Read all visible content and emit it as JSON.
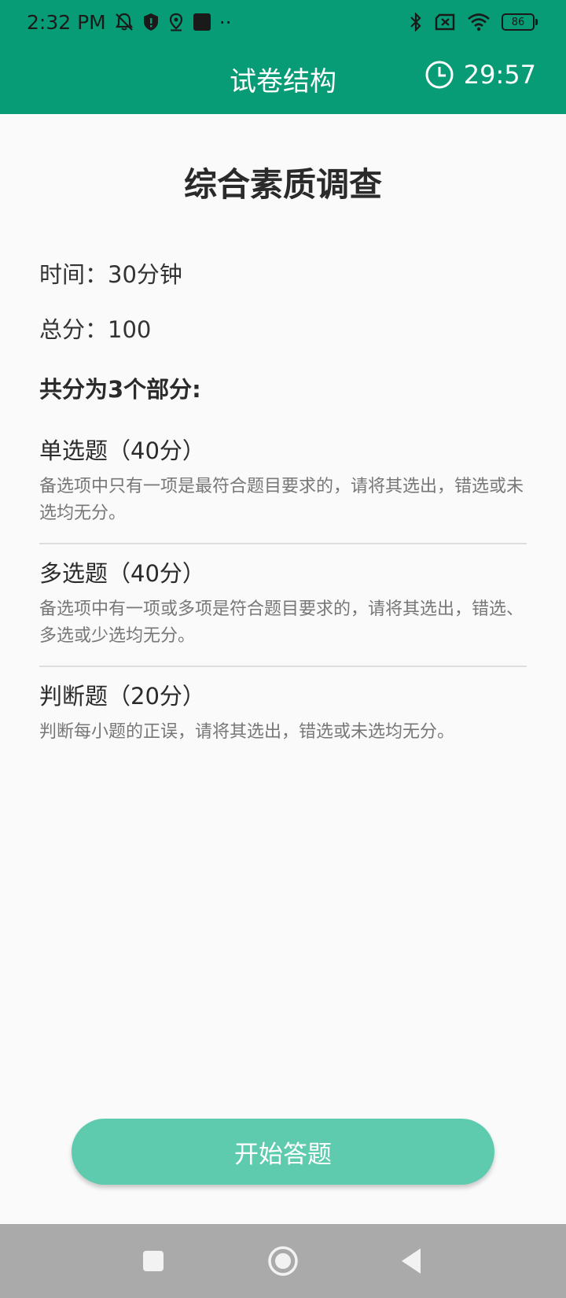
{
  "status_bar": {
    "time": "2:32 PM",
    "dots": "··",
    "battery": "86",
    "icons_left": [
      "muted-notification-icon",
      "shield-icon",
      "location-icon",
      "app-square-icon"
    ],
    "icons_right": [
      "bluetooth-icon",
      "no-sim-icon",
      "wifi-icon",
      "battery-icon"
    ]
  },
  "app_bar": {
    "title": "试卷结构",
    "timer": "29:57",
    "timer_icon": "clock-icon"
  },
  "exam": {
    "title": "综合素质调查",
    "time_label": "时间：30分钟",
    "score_label": "总分：100",
    "parts_heading": "共分为3个部分:",
    "sections": [
      {
        "title": "单选题（40分）",
        "description": "备选项中只有一项是最符合题目要求的，请将其选出，错选或未选均无分。"
      },
      {
        "title": "多选题（40分）",
        "description": "备选项中有一项或多项是符合题目要求的，请将其选出，错选、多选或少选均无分。"
      },
      {
        "title": "判断题（20分）",
        "description": "判断每小题的正误，请将其选出，错选或未选均无分。"
      }
    ]
  },
  "start_button": "开始答题",
  "nav_bar": {
    "icons": [
      "recents-square-icon",
      "home-circle-icon",
      "back-triangle-icon"
    ]
  },
  "colors": {
    "primary": "#079c75",
    "button": "#5ecbaf",
    "background": "#fafafa",
    "nav_bar": "#aaaaaa"
  }
}
